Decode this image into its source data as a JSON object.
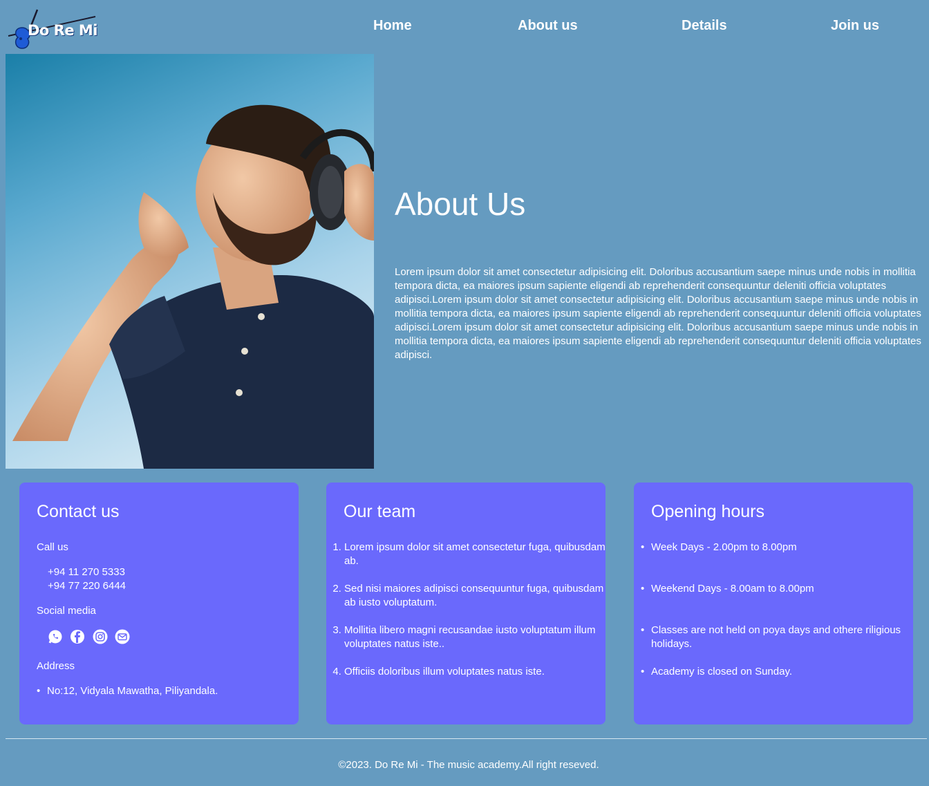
{
  "brand": {
    "logo_text": "Do Re Mi"
  },
  "nav": {
    "items": [
      {
        "label": "Home"
      },
      {
        "label": "About us"
      },
      {
        "label": "Details"
      },
      {
        "label": "Join us"
      }
    ]
  },
  "hero": {
    "title": "About Us",
    "body": "Lorem ipsum dolor sit amet consectetur adipisicing elit. Doloribus accusantium saepe minus unde nobis in mollitia tempora dicta, ea maiores ipsum sapiente eligendi ab reprehenderit consequuntur deleniti officia voluptates adipisci.Lorem ipsum dolor sit amet consectetur adipisicing elit. Doloribus accusantium saepe minus unde nobis in mollitia tempora dicta, ea maiores ipsum sapiente eligendi ab reprehenderit consequuntur deleniti officia voluptates adipisci.Lorem ipsum dolor sit amet consectetur adipisicing elit. Doloribus accusantium saepe minus unde nobis in mollitia tempora dicta, ea maiores ipsum sapiente eligendi ab reprehenderit consequuntur deleniti officia voluptates adipisci."
  },
  "contact": {
    "title": "Contact us",
    "call_label": "Call us",
    "phones": [
      "+94 11 270 5333",
      "+94 77 220 6444"
    ],
    "social_label": "Social media",
    "social_icons": [
      "whatsapp-icon",
      "facebook-icon",
      "instagram-icon",
      "email-icon"
    ],
    "address_label": "Address",
    "address": "No:12, Vidyala Mawatha, Piliyandala."
  },
  "team": {
    "title": "Our team",
    "items": [
      "Lorem ipsum dolor sit amet consectetur fuga, quibusdam ab.",
      "Sed nisi maiores adipisci consequuntur fuga, quibusdam ab iusto voluptatum.",
      "Mollitia libero magni recusandae iusto voluptatum illum voluptates natus iste..",
      "Officiis doloribus illum voluptates natus iste."
    ]
  },
  "hours": {
    "title": "Opening hours",
    "items": [
      "Week Days - 2.00pm to 8.00pm",
      "Weekend Days - 8.00am to 8.00pm",
      "Classes are not held on poya days and othere riligious holidays.",
      "Academy is closed on Sunday."
    ]
  },
  "colors": {
    "page_bg": "#659bc0",
    "card_bg": "#6a69fc",
    "text": "#ffffff"
  },
  "footer": {
    "text": "©2023. Do Re Mi - The music academy.All right reseved."
  }
}
